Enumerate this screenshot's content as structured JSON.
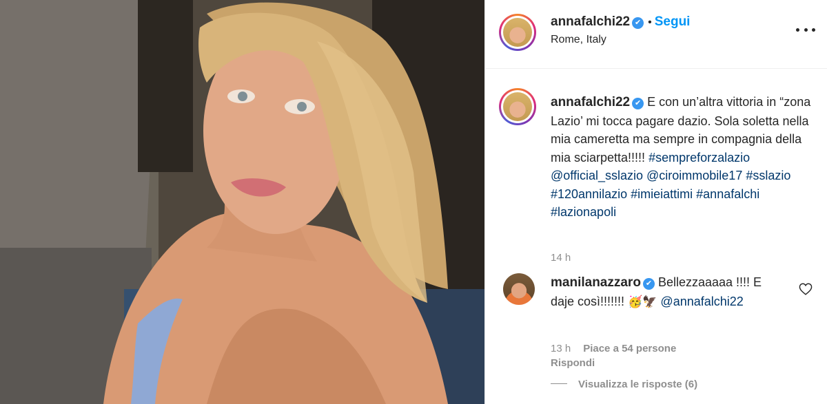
{
  "post": {
    "author": {
      "username": "annafalchi22",
      "verified_badge": "✔",
      "location": "Rome, Italy",
      "follow_label": "Segui",
      "separator": "•"
    },
    "caption": {
      "username": "annafalchi22",
      "text": "E con un’altra vittoria in “zona Lazio’ mi tocca pagare dazio. Sola soletta nella mia cameretta ma sempre in compagnia della mia sciarpetta!!!!! ",
      "hashtag_line_1": "#sempreforzalazio",
      "mention_1": "@official_sslazio",
      "mention_2": "@ciroimmobile17",
      "hashtag_2": "#sslazio",
      "hashtag_3": "#120annilazio",
      "hashtag_4": "#imieiattimi",
      "hashtag_5": "#annafalchi",
      "hashtag_6": "#lazionapoli",
      "time": "14 h"
    },
    "comment": {
      "username": "manilanazzaro",
      "verified_badge": "✔",
      "text": "Bellezzaaaaa !!!! E daje così!!!!!!! ",
      "emojis": "🥳🦅",
      "mention": "@annafalchi22",
      "time": "13 h",
      "likes_label": "Piace a 54 persone",
      "reply_label": "Rispondi",
      "view_replies_label": "Visualizza le risposte (6)"
    }
  },
  "colors": {
    "link": "#00376b",
    "follow": "#0095f6",
    "verified": "#3897f0",
    "muted": "#8e8e8e"
  },
  "icons": [
    "more-options-icon",
    "verified-icon",
    "heart-icon"
  ]
}
